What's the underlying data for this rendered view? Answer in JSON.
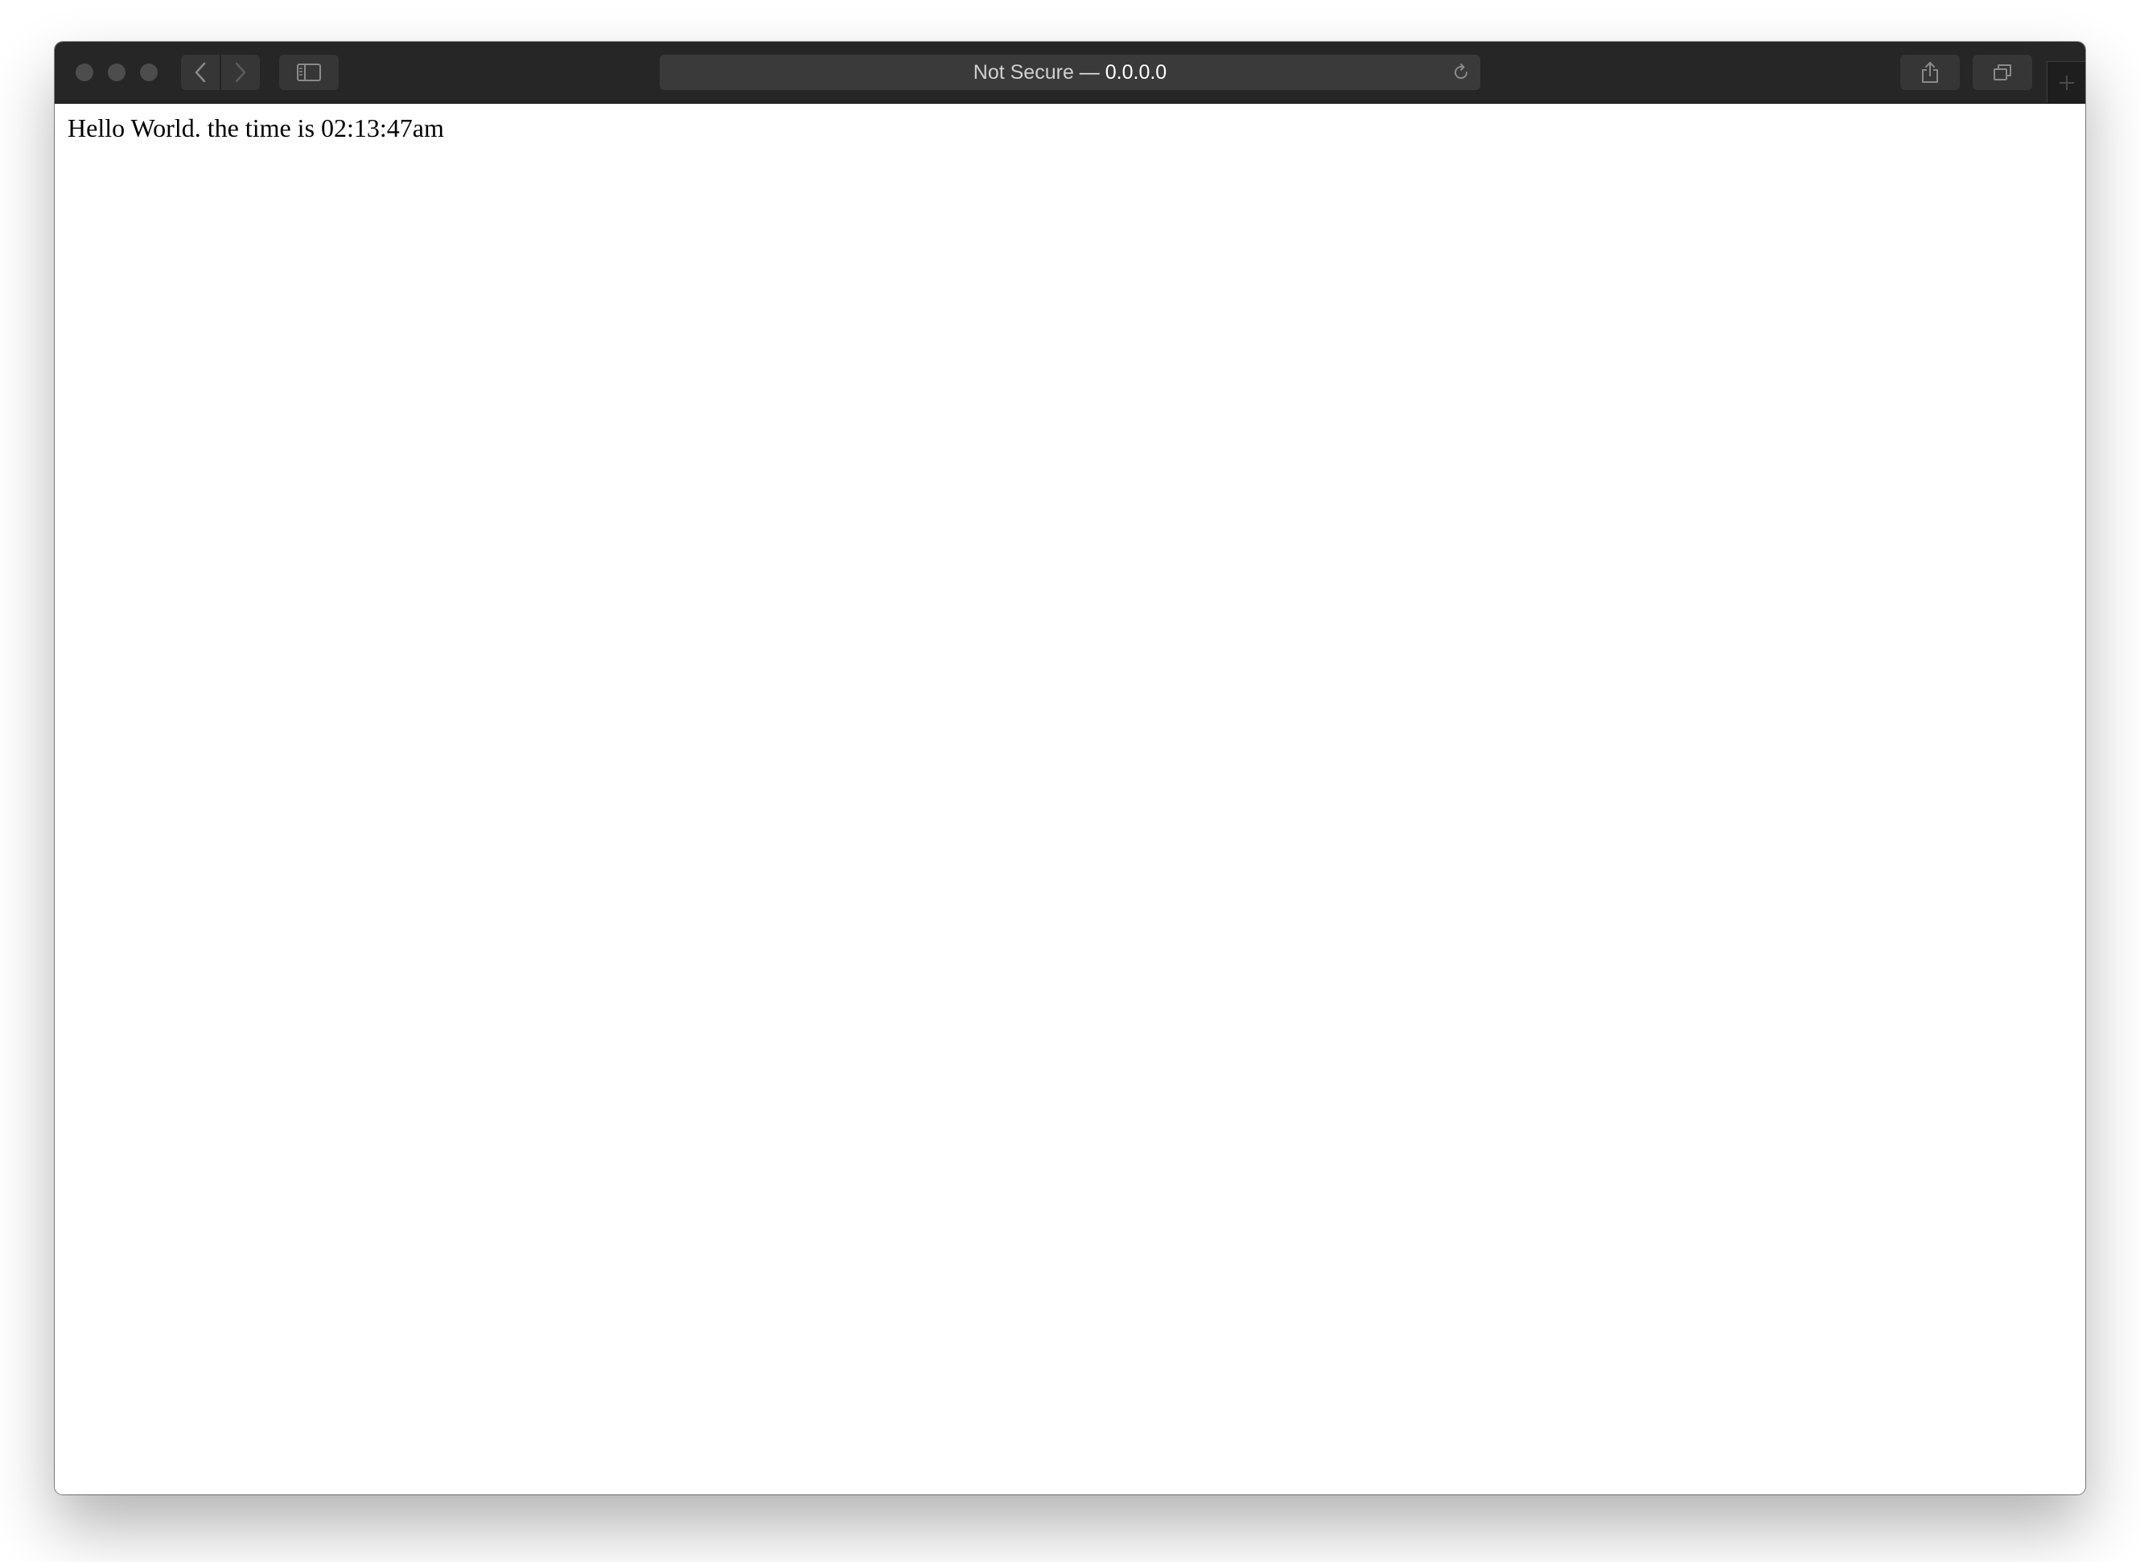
{
  "browser": {
    "address_bar": {
      "security_label": "Not Secure",
      "separator": " — ",
      "host": "0.0.0.0"
    },
    "icons": {
      "back": "chevron-left-icon",
      "forward": "chevron-right-icon",
      "sidebar": "sidebar-icon",
      "reload": "reload-icon",
      "share": "share-icon",
      "tabs": "tab-overview-icon",
      "new_tab": "plus-icon"
    },
    "colors": {
      "toolbar": "#262626",
      "address_bar": "#3a3a3a",
      "button": "#363636"
    }
  },
  "page": {
    "text": "Hello World. the time is 02:13:47am"
  }
}
